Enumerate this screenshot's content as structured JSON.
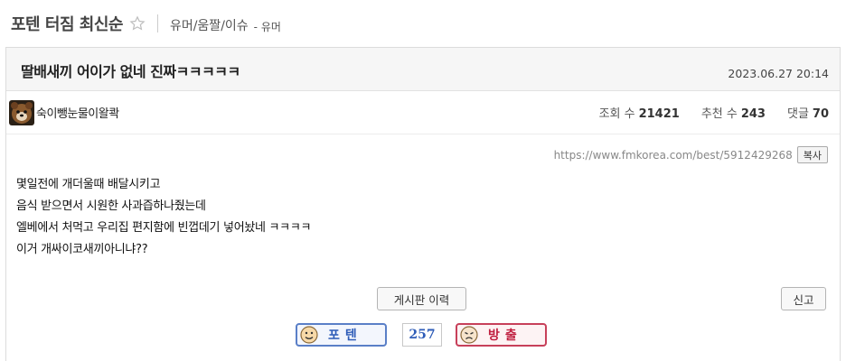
{
  "board": {
    "title": "포텐 터짐 최신순",
    "category_path": "유머/움짤/이슈",
    "category_sub": "- 유머"
  },
  "post": {
    "title": "딸배새끼 어이가 없네 진짜ㅋㅋㅋㅋㅋ",
    "date": "2023.06.27 20:14",
    "author": "숙이뺑눈물이왈콱",
    "views_label": "조회 수",
    "views": "21421",
    "recommends_label": "추천 수",
    "recommends": "243",
    "comments_label": "댓글",
    "comments": "70",
    "url": "https://www.fmkorea.com/best/5912429268",
    "copy_label": "복사",
    "body_lines": [
      "몇일전에 개더울때 배달시키고",
      "음식 받으면서 시원한 사과즙하나줬는데",
      "엘베에서 처먹고 우리집 편지함에 빈껍데기 넣어놨네 ㅋㅋㅋㅋ",
      "이거 개싸이코새끼아니냐??"
    ]
  },
  "actions": {
    "history_label": "게시판 이력",
    "report_label": "신고",
    "vote_up_label": "포텐",
    "vote_count": "257",
    "vote_down_label": "방출"
  },
  "colors": {
    "vote_up": "#2f5db8",
    "vote_down": "#c02040"
  }
}
